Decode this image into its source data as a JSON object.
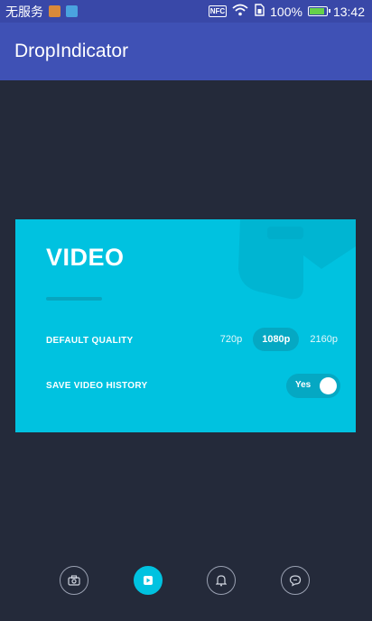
{
  "status_bar": {
    "carrier": "无服务",
    "nfc": "NFC",
    "battery_percent": "100%",
    "time": "13:42",
    "battery_level": 1.0
  },
  "app_bar": {
    "title": "DropIndicator"
  },
  "card": {
    "title": "VIDEO",
    "default_quality": {
      "label": "DEFAULT QUALITY",
      "options": [
        "720p",
        "1080p",
        "2160p"
      ],
      "selected": "1080p"
    },
    "save_history": {
      "label": "SAVE VIDEO HISTORY",
      "toggle_label": "Yes",
      "on": true
    }
  },
  "bottom_nav": {
    "items": [
      {
        "icon": "camera-icon",
        "active": false
      },
      {
        "icon": "video-icon",
        "active": true
      },
      {
        "icon": "bell-icon",
        "active": false
      },
      {
        "icon": "chat-icon",
        "active": false
      }
    ]
  },
  "colors": {
    "background": "#242a3a",
    "app_bar": "#3f51b5",
    "status_bar": "#3948a8",
    "card": "#00c2e0",
    "card_dark": "#05a8c3"
  }
}
